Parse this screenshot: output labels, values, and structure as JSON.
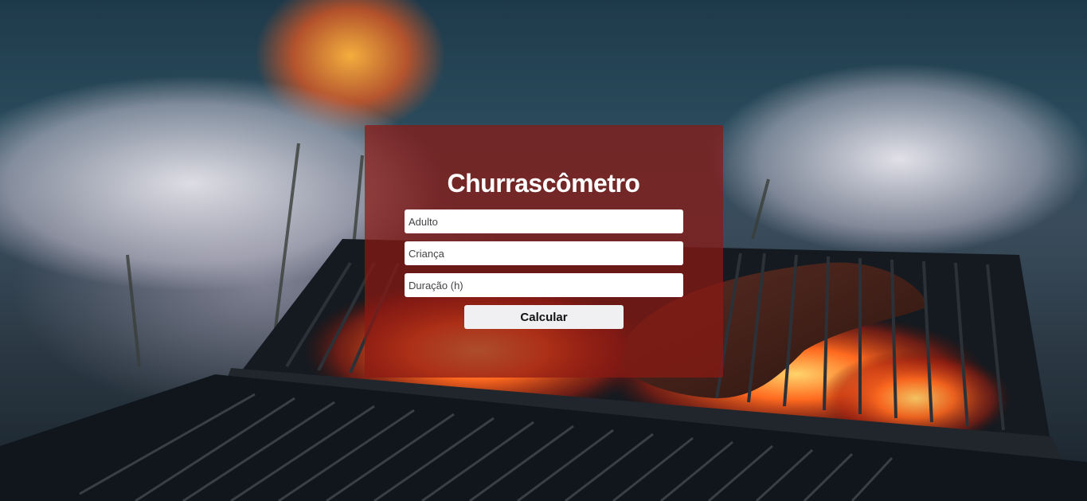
{
  "app": {
    "title": "Churrascômetro"
  },
  "form": {
    "adult_placeholder": "Adulto",
    "child_placeholder": "Criança",
    "duration_placeholder": "Duração (h)",
    "submit_label": "Calcular"
  },
  "colors": {
    "card_overlay": "#8c1914",
    "button_bg": "#f0f0f2",
    "title_text": "#ffffff"
  },
  "background": {
    "subject": "charcoal grill with flames and meat"
  }
}
